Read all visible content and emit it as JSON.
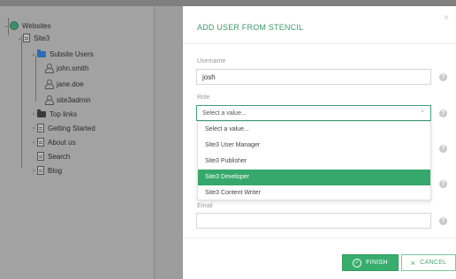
{
  "tree": {
    "root": {
      "label": "Websites",
      "icon": "globe-icon"
    },
    "site": {
      "label": "Site3",
      "icon": "page-icon"
    },
    "folder": {
      "label": "Subsite Users",
      "icon": "folder-icon"
    },
    "users": [
      {
        "label": "john.smith",
        "icon": "user-icon"
      },
      {
        "label": "jane.doe",
        "icon": "user-icon"
      },
      {
        "label": "site3admin",
        "icon": "user-icon"
      }
    ],
    "items": [
      {
        "label": "Top links",
        "icon": "folder-icon",
        "expand": "›"
      },
      {
        "label": "Getting Started",
        "icon": "page-icon",
        "expand": "›"
      },
      {
        "label": "About us",
        "icon": "page-icon",
        "expand": "›"
      },
      {
        "label": "Search",
        "icon": "page-icon",
        "expand": ""
      },
      {
        "label": "Blog",
        "icon": "page-icon",
        "expand": "›"
      }
    ]
  },
  "modal": {
    "title": "ADD USER FROM STENCIL",
    "close": "×",
    "username_label": "Username",
    "username_value": "josh",
    "role_label": "Role",
    "role_selected": "Select a value...",
    "role_options": [
      "Select a value...",
      "Site3 User Manager",
      "Site3 Publisher",
      "Site3 Developer",
      "Site3 Content Writer"
    ],
    "role_highlighted": "Site3 Developer",
    "email_label": "Email",
    "email_value": "",
    "help": "?",
    "finish_label": "FINISH",
    "cancel_label": "CANCEL"
  },
  "colors": {
    "accent": "#36a86b",
    "title": "#3a9a6a"
  }
}
